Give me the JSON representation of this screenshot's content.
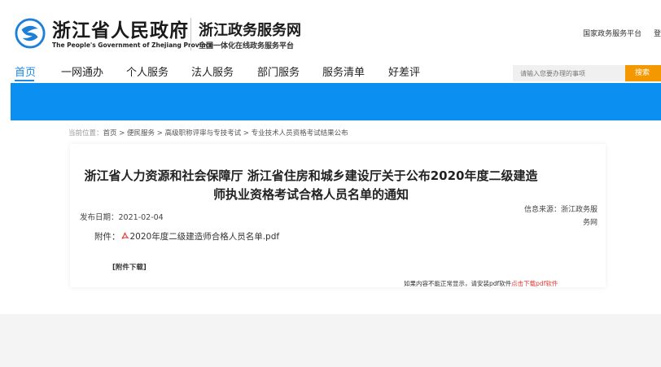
{
  "header": {
    "brand_cn": "浙江省人民政府",
    "brand_en": "The People's Government of Zhejiang Province",
    "site_title": "浙江政务服务网",
    "site_subtitle": "全国一体化在线政务服务平台",
    "top_links": [
      "国家政务服务平台",
      "登"
    ]
  },
  "nav": {
    "items": [
      "首页",
      "一网通办",
      "个人服务",
      "法人服务",
      "部门服务",
      "服务清单",
      "好差评"
    ],
    "active_index": 0,
    "search_placeholder": "请输入您要办理的事项",
    "search_button": "搜索"
  },
  "breadcrumb": {
    "label": "当前位置：",
    "path": "首页 > 便民服务 > 高级职称评审与专技考试 > 专业技术人员资格考试结果公布"
  },
  "article": {
    "title": "浙江省人力资源和社会保障厅 浙江省住房和城乡建设厅关于公布2020年度二级建造师执业资格考试合格人员名单的通知",
    "date_label": "发布日期：",
    "date": "2021-02-04",
    "source_label": "信息来源：",
    "source": "浙江政务服务网",
    "attachment_label": "附件：",
    "attachment_file": "2020年度二级建造师合格人员名单.pdf",
    "download_label": "[附件下载]",
    "notice_text": "如果内容不能正常显示，请安装pdf软件",
    "notice_link": "点击下载pdf软件"
  },
  "colors": {
    "accent": "#1e88e5",
    "banner": "#0b8ff0",
    "search_button": "#f39800",
    "link_red": "#e53935"
  }
}
